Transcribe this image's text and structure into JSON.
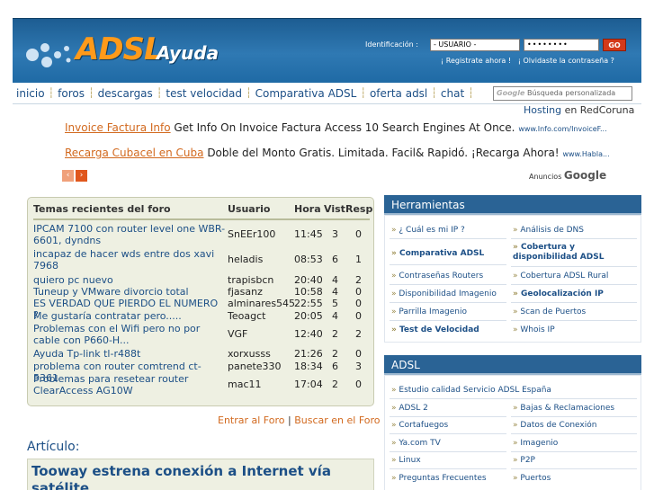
{
  "header": {
    "logo_main": "ADSL",
    "logo_sub": "Ayuda",
    "login_label": "Identificación :",
    "user_value": "- USUARIO -",
    "pass_value": "••••••••",
    "go_label": "GO",
    "register_link": "¡ Registrate ahora !",
    "forgot_link": "¡ Olvidaste la contraseña ?"
  },
  "nav": {
    "items": [
      "inicio",
      "foros",
      "descargas",
      "test velocidad",
      "Comparativa ADSL",
      "oferta adsl",
      "chat"
    ],
    "search_logo": "Google",
    "search_placeholder": "Búsqueda personalizada"
  },
  "hosting": {
    "label": "Hosting",
    "suffix": "en RedCoruna"
  },
  "ads": [
    {
      "title": "Invoice Factura Info",
      "text": "Get Info On Invoice Factura Access 10 Search Engines At Once.",
      "url": "www.Info.com/InvoiceF..."
    },
    {
      "title": "Recarga Cubacel en Cuba",
      "text": "Doble del Monto Gratis. Limitada. Facil& Rapidó. ¡Recarga Ahora!",
      "url": "www.Habla..."
    }
  ],
  "adsby": {
    "label": "Anuncios",
    "brand": "Google"
  },
  "forum": {
    "headers": [
      "Temas recientes del foro",
      "Usuario",
      "Hora",
      "Vist",
      "Resp"
    ],
    "rows": [
      {
        "topic": "IPCAM 7100 con router level one WBR-6601, dyndns",
        "user": "SnEEr100",
        "time": "11:45",
        "views": "3",
        "replies": "0"
      },
      {
        "topic": "incapaz de hacer wds entre dos xavi 7968",
        "user": "heladis",
        "time": "08:53",
        "views": "6",
        "replies": "1"
      },
      {
        "topic": "quiero pc nuevo",
        "user": "trapisbcn",
        "time": "20:40",
        "views": "4",
        "replies": "2"
      },
      {
        "topic": "Tuneup y VMware divorcio total",
        "user": "fjasanz",
        "time": "10:58",
        "views": "4",
        "replies": "0"
      },
      {
        "topic": "ES VERDAD QUE PIERDO EL NUMERO ?",
        "user": "alminares545",
        "time": "22:55",
        "views": "5",
        "replies": "0"
      },
      {
        "topic": "Me gustaría contratar pero.....",
        "user": "Teoagct",
        "time": "20:05",
        "views": "4",
        "replies": "0"
      },
      {
        "topic": "Problemas con el Wifi pero no por cable con P660-H...",
        "user": "VGF",
        "time": "12:40",
        "views": "2",
        "replies": "2"
      },
      {
        "topic": "Ayuda Tp-link tl-r488t",
        "user": "xorxusss",
        "time": "21:26",
        "views": "2",
        "replies": "0"
      },
      {
        "topic": "problema con router comtrend ct-5361",
        "user": "panete330",
        "time": "18:34",
        "views": "6",
        "replies": "3"
      },
      {
        "topic": "Problemas para resetear router ClearAccess AG10W",
        "user": "mac11",
        "time": "17:04",
        "views": "2",
        "replies": "0"
      }
    ],
    "link_forum": "Entrar al Foro",
    "link_search": "Buscar en el Foro",
    "separator": "|"
  },
  "article": {
    "label": "Artículo:",
    "title": "Tooway estrena conexión a Internet vía satélite"
  },
  "sidebar": {
    "herramientas_title": "Herramientas",
    "herramientas": [
      [
        "¿ Cuál es mi IP ?",
        "Análisis de DNS"
      ],
      [
        "Comparativa ADSL",
        "Cobertura y disponibilidad ADSL"
      ],
      [
        "Contraseñas Routers",
        "Cobertura ADSL Rural"
      ],
      [
        "Disponibilidad Imagenio",
        "Geolocalización IP"
      ],
      [
        "Parrilla Imagenio",
        "Scan de Puertos"
      ],
      [
        "Test de Velocidad",
        "Whois IP"
      ]
    ],
    "adsl_title": "ADSL",
    "adsl_full": "Estudio calidad Servicio ADSL España",
    "adsl": [
      [
        "ADSL 2",
        "Bajas & Reclamaciones"
      ],
      [
        "Cortafuegos",
        "Datos de Conexión"
      ],
      [
        "Ya.com TV",
        "Imagenio"
      ],
      [
        "Linux",
        "P2P"
      ],
      [
        "Preguntas Frecuentes",
        "Puertos"
      ]
    ],
    "arrow": "»"
  },
  "colors": {
    "header_blue": "#2f79b3",
    "link_blue": "#1c4f86",
    "ad_orange": "#d2691e",
    "forum_bg": "#eef0e2",
    "panel_head": "#2a6395"
  }
}
